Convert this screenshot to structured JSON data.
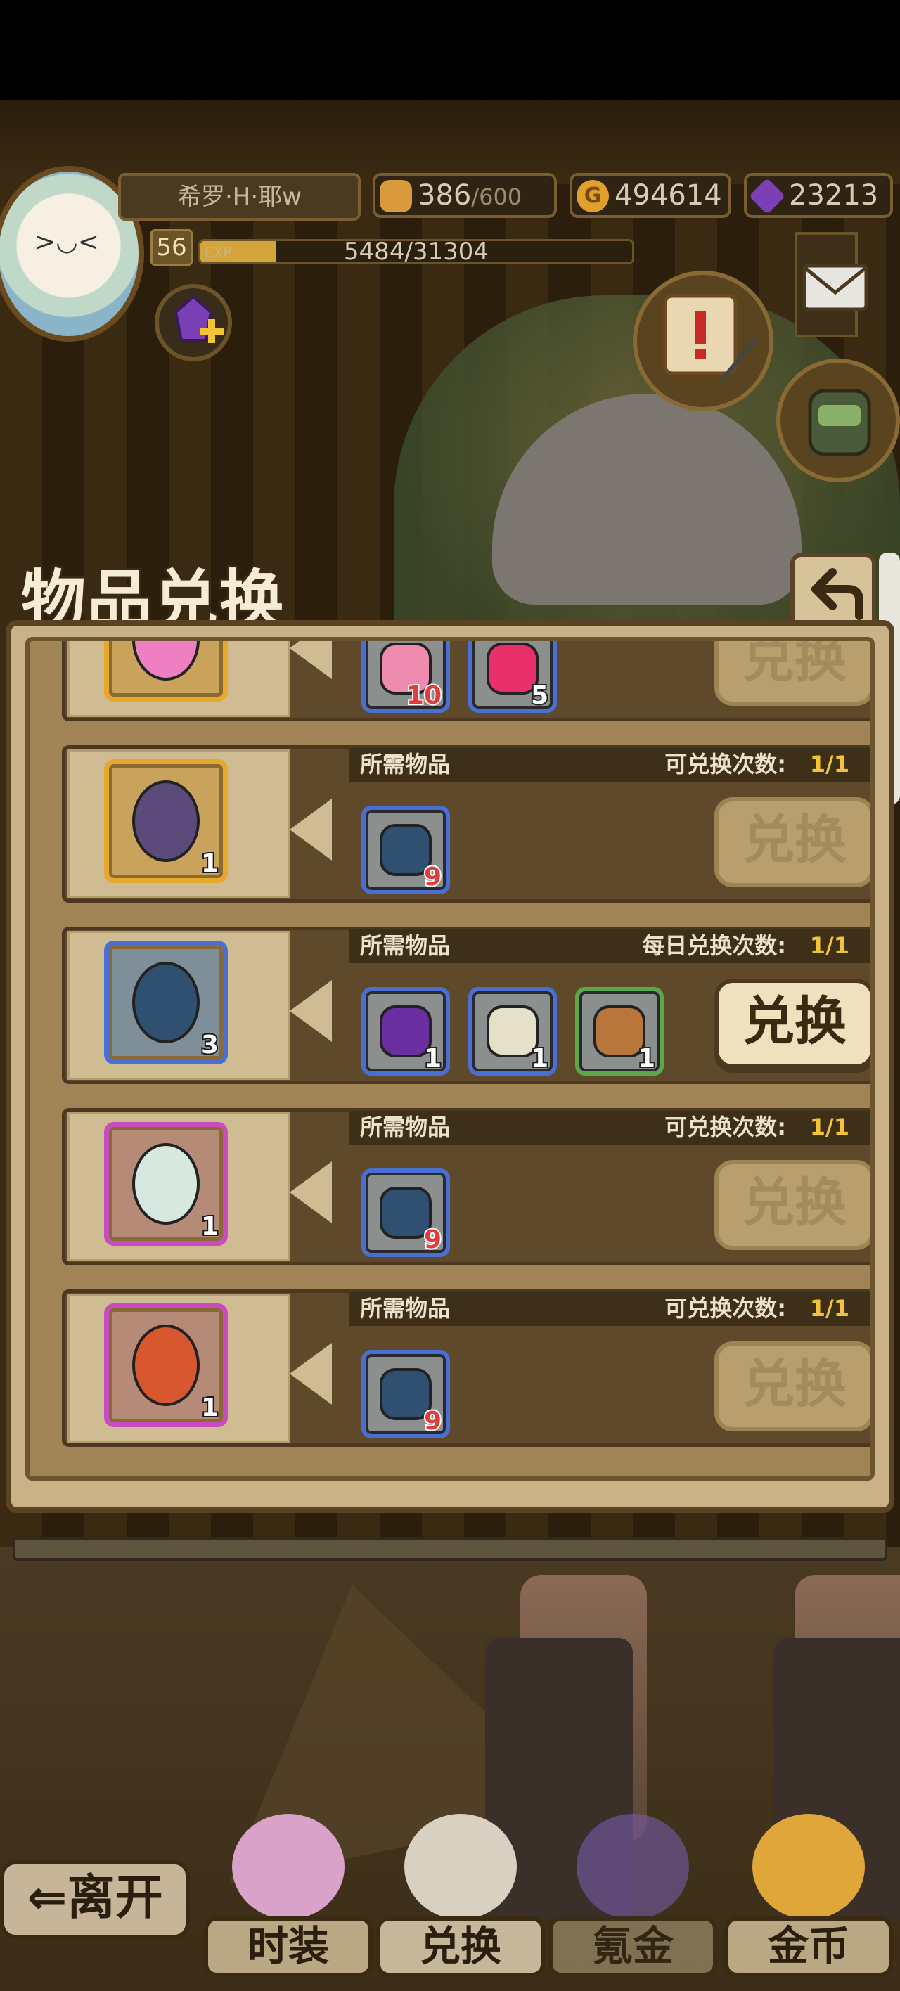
{
  "player": {
    "name": "希罗·H·耶w",
    "level": "56",
    "exp_label": "EXP",
    "exp": "5484/31304",
    "exp_fraction": 0.175
  },
  "resources": {
    "stamina_value": "386",
    "stamina_max": "/600",
    "gold": "494614",
    "gems": "23213",
    "gold_icon_letter": "G"
  },
  "panel": {
    "title": "物品兑换",
    "back_icon": "back-arrow-icon"
  },
  "rows": [
    {
      "reward_icon": "pink-bow-icon",
      "reward_color": "gold",
      "reward_count": "",
      "show_head": false,
      "required": [
        {
          "icon": "pink-slime-icon",
          "count": "10",
          "ok": false,
          "color": "blue"
        },
        {
          "icon": "pink-orb-icon",
          "count": "5",
          "ok": true,
          "color": "blue"
        }
      ],
      "button": "兑换",
      "active": false
    },
    {
      "reward_icon": "figure-dark-hair-girl-icon",
      "reward_color": "gold",
      "reward_count": "1",
      "show_head": true,
      "head_req": "所需物品",
      "head_label": "可兑换次数:",
      "head_value": "1/1",
      "required": [
        {
          "icon": "blue-scroll-bundle-icon",
          "count": "9",
          "ok": false,
          "color": "blue"
        }
      ],
      "button": "兑换",
      "active": false
    },
    {
      "reward_icon": "blue-scroll-bundle-icon",
      "reward_color": "blue",
      "reward_count": "3",
      "show_head": true,
      "head_req": "所需物品",
      "head_label": "每日兑换次数:",
      "head_value": "1/1",
      "required": [
        {
          "icon": "purple-coin-icon",
          "count": "1",
          "ok": true,
          "color": "blue"
        },
        {
          "icon": "map-scroll-icon",
          "count": "1",
          "ok": true,
          "color": "blue"
        },
        {
          "icon": "mushroom-pudding-icon",
          "count": "1",
          "ok": true,
          "color": "green"
        }
      ],
      "button": "兑换",
      "active": true
    },
    {
      "reward_icon": "figure-umbrella-girl-icon",
      "reward_color": "purple",
      "reward_count": "1",
      "show_head": true,
      "head_req": "所需物品",
      "head_label": "可兑换次数:",
      "head_value": "1/1",
      "required": [
        {
          "icon": "blue-scroll-bundle-icon",
          "count": "9",
          "ok": false,
          "color": "blue"
        }
      ],
      "button": "兑换",
      "active": false
    },
    {
      "reward_icon": "figure-dragon-girl-icon",
      "reward_color": "purple",
      "reward_count": "1",
      "show_head": true,
      "head_req": "所需物品",
      "head_label": "可兑换次数:",
      "head_value": "1/1",
      "required": [
        {
          "icon": "blue-scroll-bundle-icon",
          "count": "9",
          "ok": false,
          "color": "blue"
        }
      ],
      "button": "兑换",
      "active": false
    }
  ],
  "nav": {
    "leave": "离开",
    "items": [
      {
        "label": "时装",
        "icon": "dress-icon",
        "state": "normal"
      },
      {
        "label": "兑换",
        "icon": "exchange-bag-icon",
        "state": "active"
      },
      {
        "label": "氪金",
        "icon": "gem-bag-icon",
        "state": "dim"
      },
      {
        "label": "金币",
        "icon": "gold-coin-bag-icon",
        "state": "normal"
      }
    ]
  },
  "colors": {
    "accent_gold": "#f2c436",
    "missing_red": "#e33b3b",
    "panel_bg": "#a08456",
    "purple_frame": "#c84bc0",
    "blue_frame": "#4a6fd4"
  }
}
